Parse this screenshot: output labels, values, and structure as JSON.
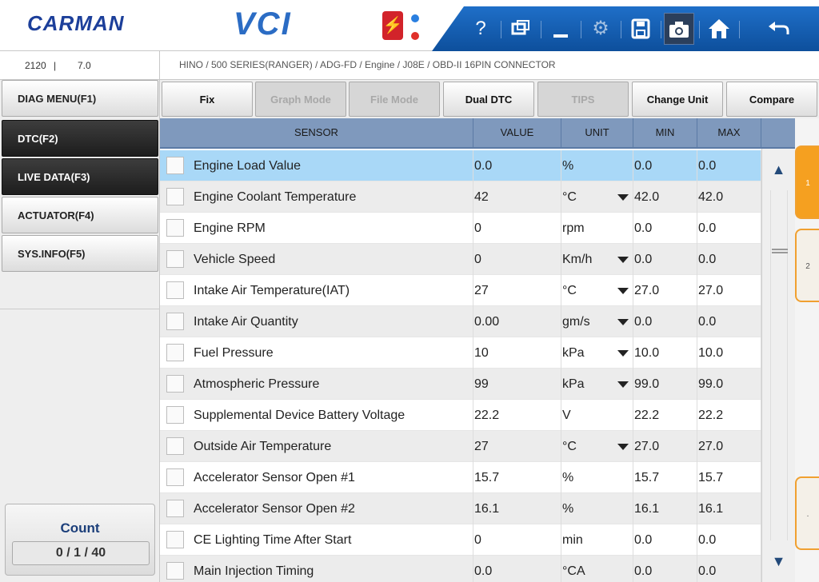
{
  "header": {
    "brand": "CARMAN",
    "product": "VCI",
    "usb_icon": "usb-icon",
    "toolbar": {
      "help_label": "?",
      "window_icon": "window-icon",
      "minimize_icon": "minimize-icon",
      "settings_icon": "settings-icon",
      "save_icon": "save-icon",
      "camera_icon": "camera-icon",
      "home_icon": "home-icon",
      "back_icon": "back-arrow-icon"
    }
  },
  "infobar": {
    "code": "2120",
    "separator": "|",
    "version": "7.0",
    "breadcrumb": "HINO / 500 SERIES(RANGER) / ADG-FD / Engine / J08E / OBD-II 16PIN CONNECTOR"
  },
  "menu": {
    "items": [
      {
        "label": "DIAG MENU(F1)",
        "style": "light"
      },
      {
        "label": "DTC(F2)",
        "style": "dark"
      },
      {
        "label": "LIVE DATA(F3)",
        "style": "dark"
      },
      {
        "label": "ACTUATOR(F4)",
        "style": "light"
      },
      {
        "label": "SYS.INFO(F5)",
        "style": "light"
      }
    ]
  },
  "count": {
    "title": "Count",
    "value": "0 / 1 / 40"
  },
  "functions": [
    {
      "label": "Fix",
      "enabled": true
    },
    {
      "label": "Graph Mode",
      "enabled": false
    },
    {
      "label": "File Mode",
      "enabled": false
    },
    {
      "label": "Dual DTC",
      "enabled": true
    },
    {
      "label": "TIPS",
      "enabled": false
    },
    {
      "label": "Change Unit",
      "enabled": true
    },
    {
      "label": "Compare",
      "enabled": true
    }
  ],
  "table": {
    "columns": [
      "SENSOR",
      "VALUE",
      "UNIT",
      "MIN",
      "MAX"
    ],
    "rows": [
      {
        "sensor": "Engine Load Value",
        "value": "0.0",
        "unit": "%",
        "dropdown": false,
        "min": "0.0",
        "max": "0.0",
        "selected": true
      },
      {
        "sensor": "Engine Coolant Temperature",
        "value": "42",
        "unit": "°C",
        "dropdown": true,
        "min": "42.0",
        "max": "42.0",
        "selected": false
      },
      {
        "sensor": "Engine RPM",
        "value": "0",
        "unit": "rpm",
        "dropdown": false,
        "min": "0.0",
        "max": "0.0",
        "selected": false
      },
      {
        "sensor": "Vehicle Speed",
        "value": "0",
        "unit": "Km/h",
        "dropdown": true,
        "min": "0.0",
        "max": "0.0",
        "selected": false
      },
      {
        "sensor": "Intake Air Temperature(IAT)",
        "value": "27",
        "unit": "°C",
        "dropdown": true,
        "min": "27.0",
        "max": "27.0",
        "selected": false
      },
      {
        "sensor": "Intake Air Quantity",
        "value": "0.00",
        "unit": "gm/s",
        "dropdown": true,
        "min": "0.0",
        "max": "0.0",
        "selected": false
      },
      {
        "sensor": "Fuel Pressure",
        "value": "10",
        "unit": "kPa",
        "dropdown": true,
        "min": "10.0",
        "max": "10.0",
        "selected": false
      },
      {
        "sensor": "Atmospheric Pressure",
        "value": "99",
        "unit": "kPa",
        "dropdown": true,
        "min": "99.0",
        "max": "99.0",
        "selected": false
      },
      {
        "sensor": "Supplemental Device Battery Voltage",
        "value": "22.2",
        "unit": "V",
        "dropdown": false,
        "min": "22.2",
        "max": "22.2",
        "selected": false
      },
      {
        "sensor": "Outside Air Temperature",
        "value": "27",
        "unit": "°C",
        "dropdown": true,
        "min": "27.0",
        "max": "27.0",
        "selected": false
      },
      {
        "sensor": "Accelerator Sensor Open #1",
        "value": "15.7",
        "unit": "%",
        "dropdown": false,
        "min": "15.7",
        "max": "15.7",
        "selected": false
      },
      {
        "sensor": "Accelerator Sensor Open #2",
        "value": "16.1",
        "unit": "%",
        "dropdown": false,
        "min": "16.1",
        "max": "16.1",
        "selected": false
      },
      {
        "sensor": "CE Lighting Time After Start",
        "value": "0",
        "unit": "min",
        "dropdown": false,
        "min": "0.0",
        "max": "0.0",
        "selected": false
      },
      {
        "sensor": "Main Injection Timing",
        "value": "0.0",
        "unit": "°CA",
        "dropdown": false,
        "min": "0.0",
        "max": "0.0",
        "selected": false
      }
    ]
  },
  "pages": {
    "tabs": [
      "1",
      "2",
      "."
    ],
    "active": "1"
  },
  "colors": {
    "header_blue": "#1c5fb4",
    "selected_row": "#a9d8f7",
    "table_header": "#7f99bd",
    "active_tab": "#f5a020",
    "usb_red": "#d2232a"
  }
}
